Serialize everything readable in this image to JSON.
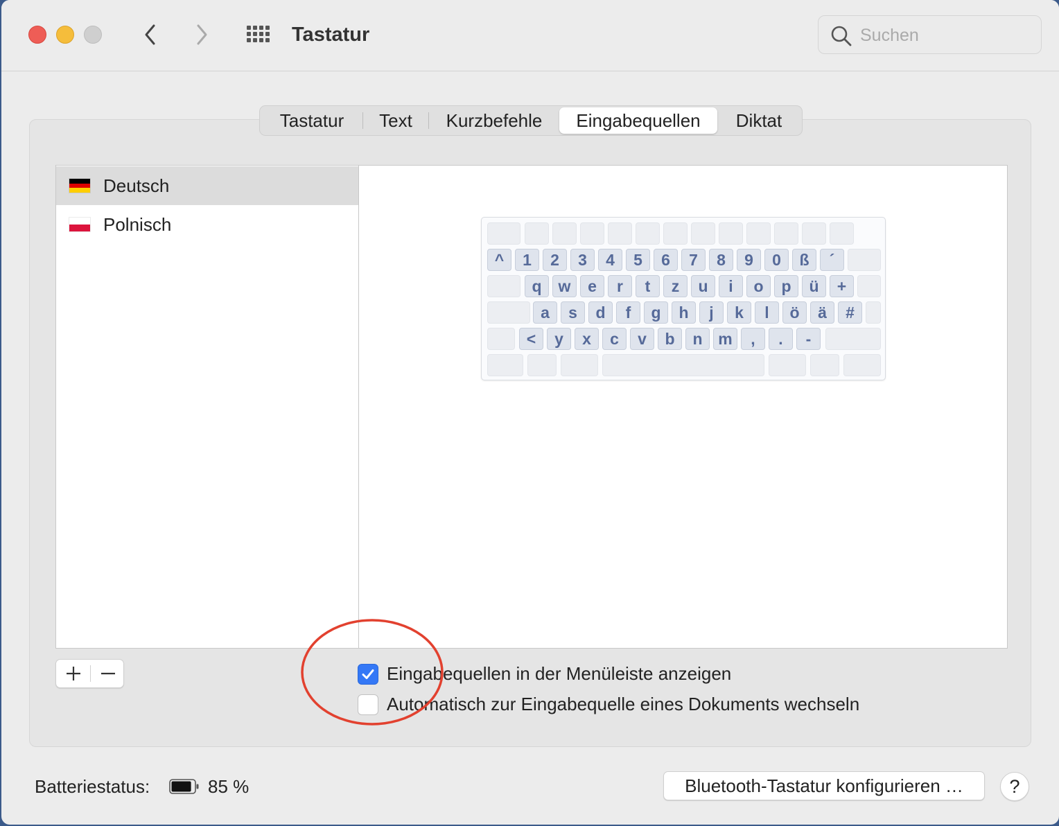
{
  "window": {
    "title": "Tastatur",
    "search_placeholder": "Suchen"
  },
  "tabs": [
    {
      "label": "Tastatur",
      "selected": false
    },
    {
      "label": "Text",
      "selected": false
    },
    {
      "label": "Kurzbefehle",
      "selected": false
    },
    {
      "label": "Eingabequellen",
      "selected": true
    },
    {
      "label": "Diktat",
      "selected": false
    }
  ],
  "input_sources": [
    {
      "label": "Deutsch",
      "flag": "germany-flag",
      "selected": true
    },
    {
      "label": "Polnisch",
      "flag": "poland-flag",
      "selected": false
    }
  ],
  "keyboard_preview": {
    "rows": [
      [
        "^",
        "1",
        "2",
        "3",
        "4",
        "5",
        "6",
        "7",
        "8",
        "9",
        "0",
        "ß",
        "´"
      ],
      [
        "q",
        "w",
        "e",
        "r",
        "t",
        "z",
        "u",
        "i",
        "o",
        "p",
        "ü",
        "+"
      ],
      [
        "a",
        "s",
        "d",
        "f",
        "g",
        "h",
        "j",
        "k",
        "l",
        "ö",
        "ä",
        "#"
      ],
      [
        "<",
        "y",
        "x",
        "c",
        "v",
        "b",
        "n",
        "m",
        ",",
        ".",
        "-"
      ]
    ]
  },
  "buttons": {
    "add": "+",
    "remove": "−",
    "bluetooth": "Bluetooth-Tastatur konfigurieren …",
    "help": "?"
  },
  "options": [
    {
      "label": "Eingabequellen in der Menüleiste anzeigen",
      "checked": true
    },
    {
      "label": "Automatisch zur Eingabequelle eines Dokuments wechseln",
      "checked": false
    }
  ],
  "battery": {
    "label": "Batteriestatus:",
    "value": "85 %",
    "level": 0.85
  },
  "colors": {
    "accent": "#3478f6",
    "annotation": "#e2412f",
    "key_label": "#566a99"
  }
}
